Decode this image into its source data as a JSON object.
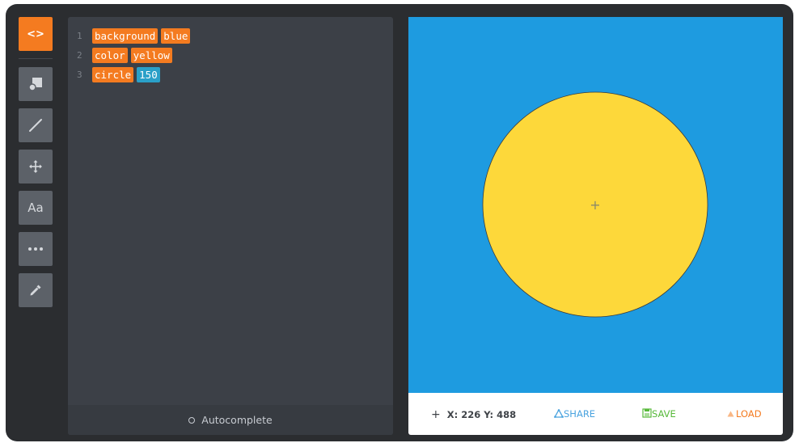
{
  "toolbar": {
    "items": [
      {
        "name": "code",
        "label": "<>",
        "icon": "code-icon",
        "active": true
      },
      {
        "name": "shapes",
        "icon": "shapes-icon"
      },
      {
        "name": "line",
        "icon": "line-icon"
      },
      {
        "name": "move",
        "icon": "move-icon"
      },
      {
        "name": "text",
        "label": "Aa",
        "icon": "text-icon"
      },
      {
        "name": "more",
        "icon": "more-icon"
      },
      {
        "name": "color-picker",
        "icon": "eyedropper-icon"
      }
    ]
  },
  "editor": {
    "lines": [
      {
        "number": "1",
        "tokens": [
          "background",
          "blue"
        ]
      },
      {
        "number": "2",
        "tokens": [
          "color",
          "yellow"
        ]
      },
      {
        "number": "3",
        "tokens": [
          "circle",
          "150"
        ]
      }
    ],
    "autocomplete_label": "Autocomplete"
  },
  "canvas": {
    "background": "#1e9be0",
    "shape_color": "#fdd83a",
    "center_marker": "+"
  },
  "statusbar": {
    "coords": "X: 226 Y: 488",
    "coords_icon": "+",
    "share_label": "SHARE",
    "save_label": "SAVE",
    "load_label": "LOAD"
  },
  "colors": {
    "accent": "#f47b20",
    "number_token": "#2aa0c8",
    "share": "#4aa3df",
    "save": "#57b93a",
    "load": "#f47b20"
  }
}
